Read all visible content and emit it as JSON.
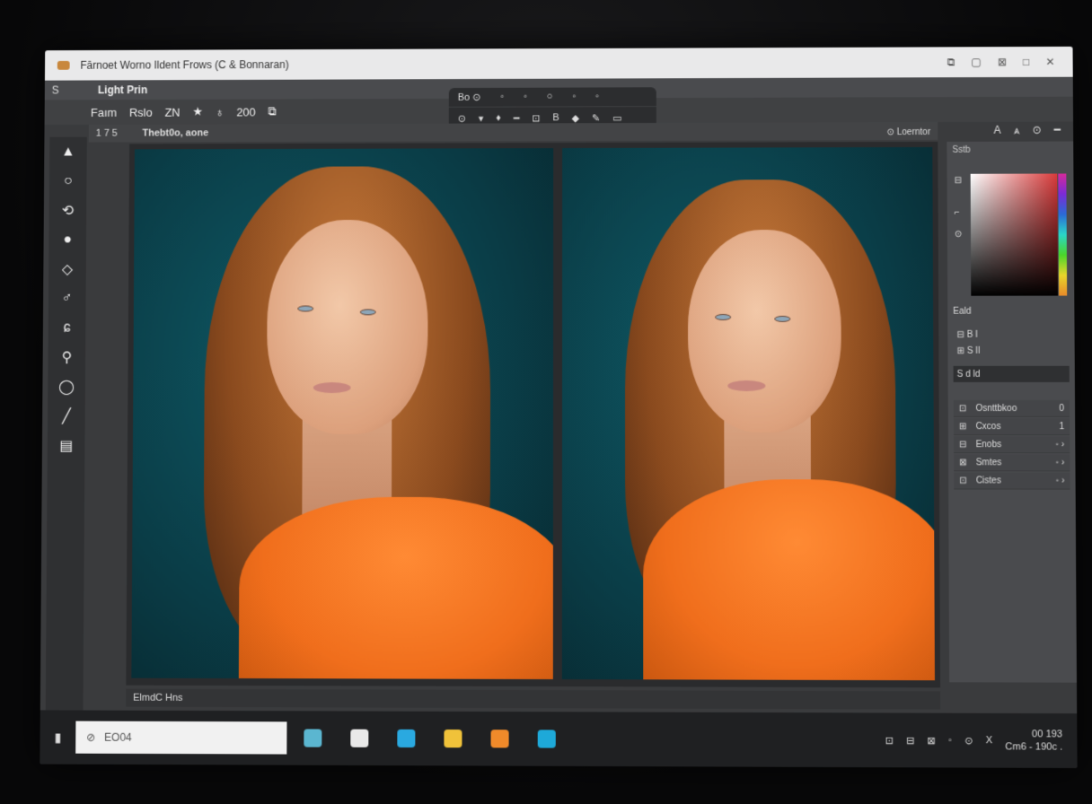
{
  "window": {
    "title": "Fārnoet  Worno Ildent  Frows (C & Bonnaran)",
    "controls": [
      "⧉",
      "▢",
      "⊠",
      "□",
      "✕"
    ]
  },
  "menubar": {
    "left_icon": "S",
    "app_name": "Light Prin"
  },
  "options": {
    "items": [
      "Faım",
      "Rslo",
      "ZN",
      "★",
      "♁",
      "200",
      "⧉"
    ]
  },
  "centerbar": {
    "row1": [
      "Bo ⊙",
      "◦",
      "◦",
      "○",
      "◦",
      "◦"
    ],
    "row2": [
      "⊙",
      "▾",
      "♦",
      "━",
      "⊡",
      "B",
      "◆",
      "✎",
      "▭"
    ]
  },
  "top_right_tools": [
    "A",
    "⩓",
    "⊙",
    "━"
  ],
  "doc_tab": {
    "left": "1 7 5",
    "name": "Thebt0o, aone"
  },
  "toolbox": {
    "tools": [
      "▲",
      "○",
      "⟲",
      "●",
      "◇",
      "♂",
      "ɕ",
      "⚲",
      "◯",
      "╱",
      "▤"
    ]
  },
  "canvas_header": {
    "label": "⊙ Loerntor"
  },
  "right_panel": {
    "color_label": "Sstb",
    "side_icons": [
      "⊟",
      "⌐",
      "⊙"
    ],
    "sub_label": "Eald",
    "rows": [
      "⊟ B I",
      "⊞ S Il",
      "S d ld"
    ],
    "layers": [
      {
        "icon": "⊡",
        "name": "Osnttbkoo",
        "val": "0"
      },
      {
        "icon": "⊞",
        "name": "Cxcos",
        "val": "1"
      },
      {
        "icon": "⊟",
        "name": "Enobs",
        "val": "◦ ›"
      },
      {
        "icon": "⊠",
        "name": "Smtes",
        "val": "◦ ›"
      },
      {
        "icon": "⊡",
        "name": "Cistes",
        "val": "◦ ›"
      }
    ]
  },
  "status": {
    "text": "ElmdC Hns"
  },
  "taskbar": {
    "start": "▮",
    "search_placeholder": "EO04",
    "apps": [
      {
        "color": "#5bb6d0"
      },
      {
        "color": "#e9e9e9"
      },
      {
        "color": "#2aa9e0"
      },
      {
        "color": "#f0c23a"
      },
      {
        "color": "#f08a2a"
      },
      {
        "color": "#1ea9d9"
      }
    ],
    "tray": [
      "⊡",
      "⊟",
      "⊠",
      "◦",
      "⊙",
      "X"
    ],
    "clock_time": "00 193",
    "clock_date": "Cm6 - 190c ."
  }
}
